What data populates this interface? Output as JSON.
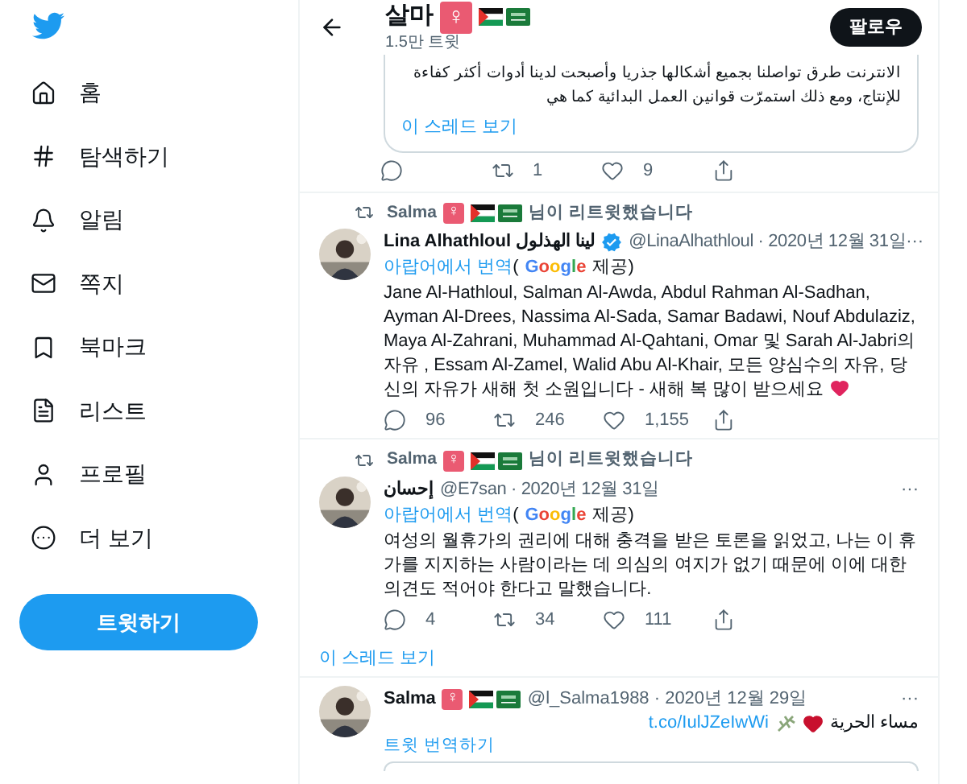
{
  "sidebar": {
    "items": [
      {
        "label": "홈"
      },
      {
        "label": "탐색하기"
      },
      {
        "label": "알림"
      },
      {
        "label": "쪽지"
      },
      {
        "label": "북마크"
      },
      {
        "label": "리스트"
      },
      {
        "label": "프로필"
      },
      {
        "label": "더 보기"
      }
    ],
    "tweet_button": "트윗하기"
  },
  "header": {
    "name": "살마",
    "badge": "♀",
    "tweet_count": "1.5만 트윗",
    "follow_button": "팔로우"
  },
  "quoted_card": {
    "lines": [
      "الانترنت طرق تواصلنا بجميع أشكالها جذريا وأصبحت لدينا أدوات أكثر كفاءة",
      "للإنتاج، ومع ذلك استمرّت قوانين العمل البدائية كما هي"
    ],
    "thread_link": "이 스레드 보기",
    "actions": [
      {
        "kind": "reply"
      },
      {
        "kind": "retweet",
        "count": "1"
      },
      {
        "kind": "like",
        "count": "9"
      },
      {
        "kind": "share"
      }
    ]
  },
  "tweets": [
    {
      "retweeted_by": "Salma",
      "retweeted_badge": "♀",
      "retweeted_suffix": "님이 리트윗했습니다",
      "name": "Lina Alhathloul لينا الهذلول",
      "verified": true,
      "handle": "@LinaAlhathloul · 2020년 12월 31일",
      "more": "···",
      "translation": {
        "link": "아랍어에서 번역",
        "open": "(",
        "provider": "Google",
        "close": "제공)"
      },
      "body": "Jane Al-Hathloul, Salman Al-Awda, Abdul Rahman Al-Sadhan, Ayman Al-Drees, Nassima Al-Sada, Samar Badawi, Nouf Abdulaziz, Maya Al-Zahrani, Muhammad Al-Qahtani, Omar 및 Sarah Al-Jabri의 자유 , Essam Al-Zamel, Walid Abu Al-Khair, 모든 양심수의 자유, 당신의 자유가 새해 첫 소원입니다 - 새해 복 많이 받으세요",
      "heart": true,
      "actions": [
        {
          "kind": "reply",
          "count": "96"
        },
        {
          "kind": "retweet",
          "count": "246"
        },
        {
          "kind": "like",
          "count": "1,155"
        },
        {
          "kind": "share"
        }
      ]
    },
    {
      "retweeted_by": "Salma",
      "retweeted_badge": "♀",
      "retweeted_suffix": "님이 리트윗했습니다",
      "name": "إحسان",
      "verified": false,
      "handle": "@E7san · 2020년 12월 31일",
      "more": "···",
      "translation": {
        "link": "아랍어에서 번역",
        "open": "(",
        "provider": "Google",
        "close": "제공)"
      },
      "body": "여성의 월휴가의 권리에 대해 충격을 받은 토론을 읽었고, 나는 이 휴가를 지지하는 사람이라는 데 의심의 여지가 없기 때문에 이에 대한 의견도 적어야 한다고 말했습니다.",
      "heart": false,
      "actions": [
        {
          "kind": "reply",
          "count": "4"
        },
        {
          "kind": "retweet",
          "count": "34"
        },
        {
          "kind": "like",
          "count": "111"
        },
        {
          "kind": "share"
        }
      ],
      "thread_link": "이 스레드 보기"
    }
  ],
  "last_tweet": {
    "name": "Salma",
    "badge": "♀",
    "handle": "@l_Salma1988 · 2020년 12월 29일",
    "more": "···",
    "text": "مساء الحرية",
    "link": "t.co/IulJZeIwWi",
    "translate": "트윗 번역하기"
  }
}
